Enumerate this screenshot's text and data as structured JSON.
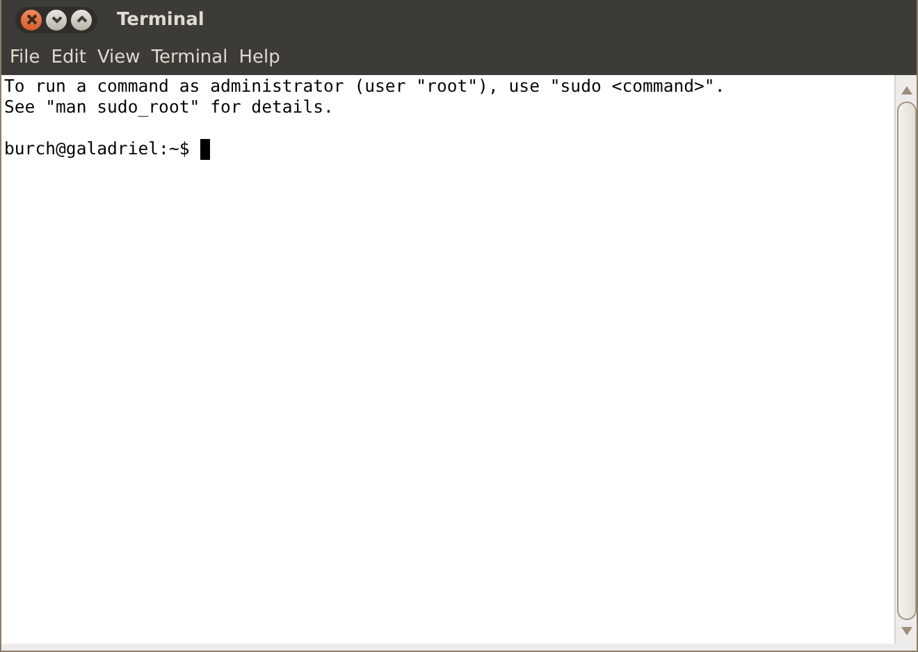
{
  "window": {
    "title": "Terminal"
  },
  "menu": [
    "File",
    "Edit",
    "View",
    "Terminal",
    "Help"
  ],
  "terminal": {
    "lines": [
      "To run a command as administrator (user \"root\"), use \"sudo <command>\".",
      "See \"man sudo_root\" for details."
    ],
    "prompt": "burch@galadriel:~$ "
  }
}
